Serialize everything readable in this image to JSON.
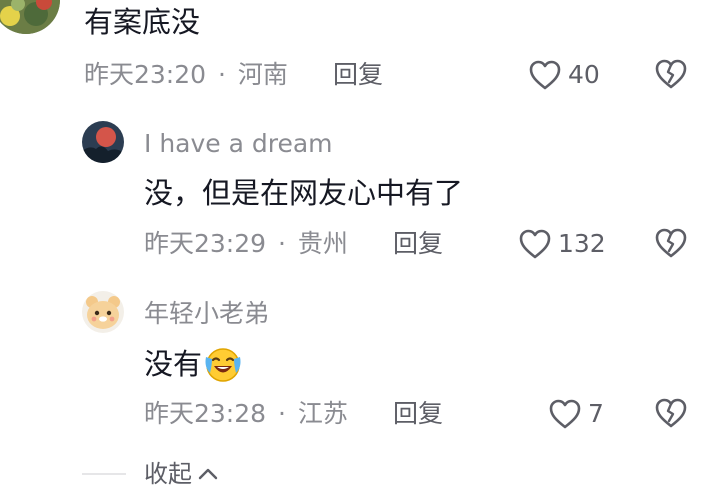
{
  "comments": [
    {
      "text": "有案底没",
      "time": "昨天23:20",
      "dot": "·",
      "location": "河南",
      "reply_label": "回复",
      "likes": "40"
    },
    {
      "username": "I have a dream",
      "text": "没，但是在网友心中有了",
      "time": "昨天23:29",
      "dot": "·",
      "location": "贵州",
      "reply_label": "回复",
      "likes": "132"
    },
    {
      "username": "年轻小老弟",
      "text": "没有",
      "emoji": "laughing-crying-face",
      "time": "昨天23:28",
      "dot": "·",
      "location": "江苏",
      "reply_label": "回复",
      "likes": "7"
    }
  ],
  "collapse": {
    "label": "收起",
    "icon": "chevron-up-icon"
  },
  "colors": {
    "text": "#161823",
    "meta": "#8a8b91",
    "action": "#5d5e66",
    "divider": "#e6e6e8"
  }
}
